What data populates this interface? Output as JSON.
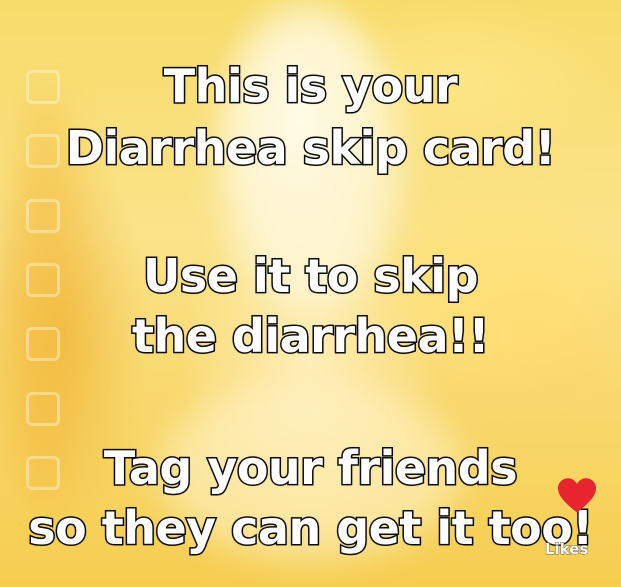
{
  "caption": {
    "line1": "This is your",
    "line2": "Diarrhea skip card!",
    "line3": "Use it to skip",
    "line4": "the diarrhea!!",
    "line5": "Tag your friends",
    "line6": "so they can get it too!"
  },
  "like_button": {
    "icon": "heart-icon",
    "label": "Likes",
    "color": "#e8242f"
  },
  "colors": {
    "background": "#f7d35a",
    "text_fill": "#ffffff",
    "text_outline": "#111111"
  }
}
